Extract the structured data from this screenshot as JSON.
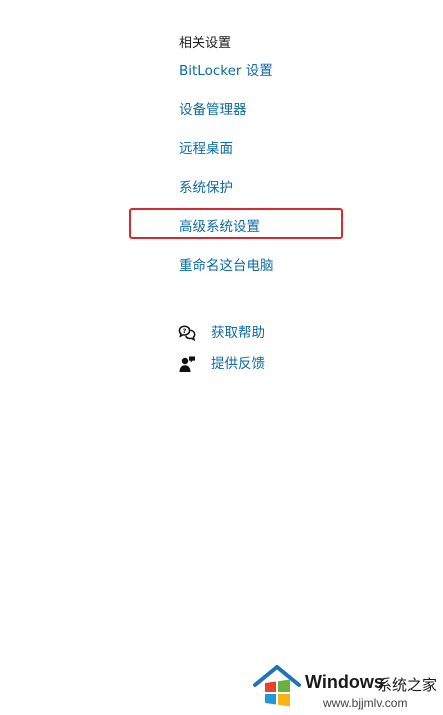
{
  "related_settings": {
    "title": "相关设置",
    "links": [
      {
        "label": "BitLocker 设置"
      },
      {
        "label": "设备管理器"
      },
      {
        "label": "远程桌面"
      },
      {
        "label": "系统保护"
      },
      {
        "label": "高级系统设置",
        "highlighted": true
      },
      {
        "label": "重命名这台电脑"
      }
    ]
  },
  "support": {
    "get_help": {
      "label": "获取帮助",
      "icon": "help-chat-icon"
    },
    "feedback": {
      "label": "提供反馈",
      "icon": "feedback-icon"
    }
  },
  "watermark": {
    "brand": "Windows",
    "brand_cn": "系统之家",
    "url": "www.bjjmlv.com"
  },
  "colors": {
    "link": "#0b6aa8",
    "highlight_border": "#d9292f",
    "text": "#1a1a1a"
  }
}
